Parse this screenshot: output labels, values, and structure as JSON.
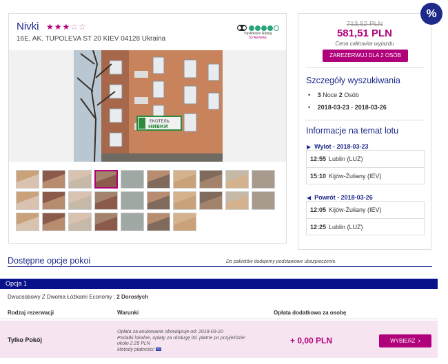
{
  "hotel": {
    "name": "Nivki",
    "stars_filled": 3,
    "stars_total": 5,
    "address": "16E, AK. TUPOLEVA ST 20 KIEV 04128 Ukraina",
    "tripadvisor": {
      "label": "TripAdvisor Rating",
      "reviews": "53 Reviews",
      "rating": 4,
      "brand_color": "#2aa57a"
    },
    "thumbnail_count": 27,
    "active_thumbnail": 4
  },
  "price": {
    "old": "713,52 PLN",
    "new": "581,51 PLN",
    "caption": "Cena całkowita wyjazdu",
    "book_label": "ZAREZERWUJ DLA 2 OSÓB"
  },
  "search": {
    "title": "Szczegóły wyszukiwania",
    "nights_num": "3",
    "nights_label": "Noce",
    "persons_num": "2",
    "persons_label": "Osób",
    "date_from": "2018-03-23",
    "date_sep": "-",
    "date_to": "2018-03-26"
  },
  "flight_info": {
    "title": "Informacje na temat lotu",
    "outbound": {
      "label": "Wylot",
      "date": "2018-03-23",
      "dep_time": "12:55",
      "dep_place": "Lublin (LUZ)",
      "arr_time": "15:10",
      "arr_place": "Kijów-Żuliany (IEV)"
    },
    "return": {
      "label": "Powrót",
      "date": "2018-03-26",
      "dep_time": "12:05",
      "dep_place": "Kijów-Żuliany (IEV)",
      "arr_time": "12:25",
      "arr_place": "Lublin (LUZ)"
    }
  },
  "promo_badge": "%",
  "rooms": {
    "title": "Dostępne opcje pokoi",
    "note": "Do pakietów dodajemy podstawowe ubezpieczenie.",
    "option_label": "Opcja 1",
    "room_desc": "Dwuosobowy Z Dwoma Łóżkami Economy :",
    "room_desc_bold": "2 Dorosłych",
    "columns": [
      "Rodzaj rezerwacji",
      "Warunki",
      "Opłata dodatkowa za osobę"
    ],
    "row": {
      "type": "Tylko Pokój",
      "conditions": [
        "Opłata za anulowanie obowiązuje od: 2018-03-20",
        "Podatki lokalne, opłaty za obsługę itd. płatne po przyjeździe:",
        "około 2.29 PLN",
        "Metody płatności:"
      ],
      "fee": "+ 0,00 PLN",
      "choose_label": "WYBIERZ"
    }
  },
  "colors": {
    "accent": "#b0007a",
    "brand": "#1d2a8a",
    "option_bar": "#08108a",
    "row_bg": "#f7e4f1"
  }
}
